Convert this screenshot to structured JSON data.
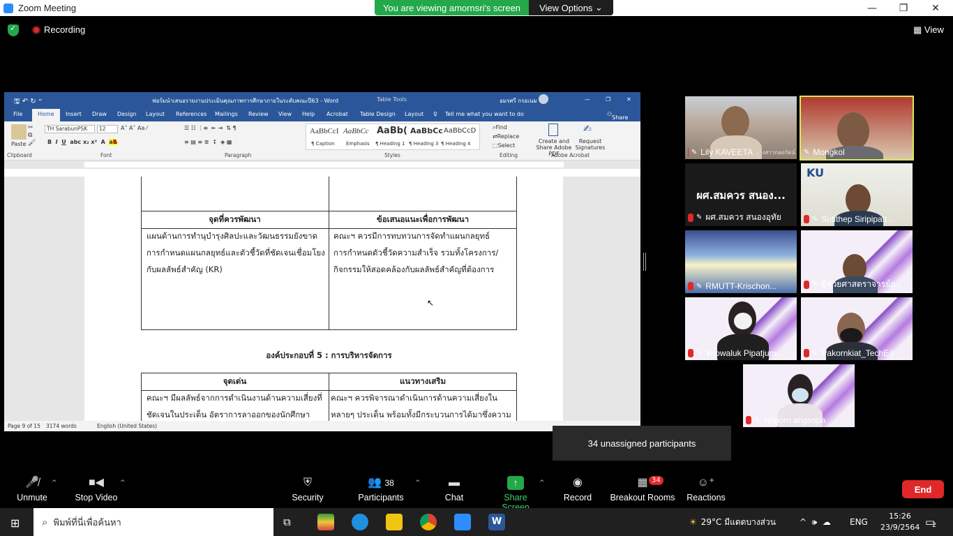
{
  "window": {
    "app_title": "Zoom Meeting",
    "viewing_banner": "You are viewing amornsri's screen",
    "view_options": "View Options"
  },
  "top": {
    "recording": "Recording",
    "view": "View"
  },
  "word": {
    "doc_title": "ฟอร์มนำเสนอรายงานประเมินคุณภาพการศึกษาภายในระดับคณะปี63 - Word",
    "table_tools": "Table Tools",
    "user": "อมรศรี กรอเนม",
    "tabs": [
      "File",
      "Home",
      "Insert",
      "Draw",
      "Design",
      "Layout",
      "References",
      "Mailings",
      "Review",
      "View",
      "Help",
      "Acrobat",
      "Table Design",
      "Layout"
    ],
    "tell_me": "Tell me what you want to do",
    "share": "Share",
    "font_name": "TH SarabunPSK",
    "font_size": "12",
    "styles": [
      {
        "preview": "AaBbCcI",
        "name": "¶ Caption"
      },
      {
        "preview": "AaBbCc",
        "name": "Emphasis"
      },
      {
        "preview": "AaBb(",
        "name": "¶ Heading 1"
      },
      {
        "preview": "AaBbCc",
        "name": "¶ Heading 3"
      },
      {
        "preview": "AaBbCcD",
        "name": "¶ Heading 4"
      }
    ],
    "editing": [
      "Find",
      "Replace",
      "Select"
    ],
    "acrobat": [
      "Create and Share Adobe PDF",
      "Request Signatures"
    ],
    "groups": [
      "Clipboard",
      "Font",
      "Paragraph",
      "Styles",
      "Editing",
      "Adobe Acrobat"
    ],
    "paste": "Paste",
    "table1": {
      "h1": "จุดที่ควรพัฒนา",
      "h2": "ข้อเสนอแนะเพื่อการพัฒนา",
      "c1": [
        "แผนด้านการทำนุบำรุงศิลปะและวัฒนธรรมยังขาด",
        "การกำหนดแผนกลยุทธ์และตัวชี้วัดที่ชัดเจนเชื่อมโยง",
        "กับผลลัพธ์สำคัญ (KR)"
      ],
      "c2": [
        "คณะฯ ควรมีการทบทวนการจัดทำแผนกลยุทธ์",
        "การกำหนดตัวชี้วัดความสำเร็จ รวมทั้งโครงการ/",
        "กิจกรรมให้สอดคล้องกับผลลัพธ์สำคัญที่ต้องการ"
      ]
    },
    "section_heading": "องค์ประกอบที่ 5 :  การบริหารจัดการ",
    "table2": {
      "h1": "จุดเด่น",
      "h2": "แนวทางเสริม",
      "c1": [
        "คณะฯ มีผลลัพธ์จากการดำเนินงานด้านความเสี่ยงที่",
        "ชัดเจนในประเด็น อัตราการลาออกของนักศึกษา"
      ],
      "c2": [
        "คณะฯ ควรพิจารณาดำเนินการด้านความเสี่ยงใน",
        "หลายๆ ประเด็น พร้อมทั้งมีกระบวนการได้มาซึ่งความ"
      ]
    },
    "status": {
      "page": "Page 9 of 15",
      "words": "3174 words",
      "lang": "English (United States)"
    }
  },
  "participants": [
    {
      "name": "Lily KAVEETA",
      "extra": "นางสาวกอดรัตน์"
    },
    {
      "name": "Mongkol"
    },
    {
      "name": "ผศ.สมควร สนองอุทัย",
      "big": "ผศ.สมควร สนอง..."
    },
    {
      "name": "Sutithep Siripipatt..."
    },
    {
      "name": "RMUTT-Krischon..."
    },
    {
      "name": "ผู้ช่วยศาสตราจารย์อ..."
    },
    {
      "name": "Yaowaluk Pipatjum..."
    },
    {
      "name": "Pakornkiat_TechEd"
    },
    {
      "name": "siriporn angsopa"
    }
  ],
  "unassigned": "34 unassigned participants",
  "toolbar": {
    "unmute": "Unmute",
    "stop_video": "Stop Video",
    "security": "Security",
    "participants": "Participants",
    "participants_count": "38",
    "chat": "Chat",
    "share_screen": "Share Screen",
    "record": "Record",
    "breakout": "Breakout Rooms",
    "breakout_count": "34",
    "reactions": "Reactions",
    "end": "End"
  },
  "taskbar": {
    "search": "พิมพ์ที่นี่เพื่อค้นหา",
    "weather": "29°C  มีแดดบางส่วน",
    "lang": "ENG",
    "time": "15:26",
    "date": "23/9/2564",
    "notif": "2"
  },
  "colors": {
    "word_blue": "#2b579a",
    "zoom_green": "#23a84a",
    "end_red": "#e02828",
    "active_speaker": "#d8e85a"
  }
}
